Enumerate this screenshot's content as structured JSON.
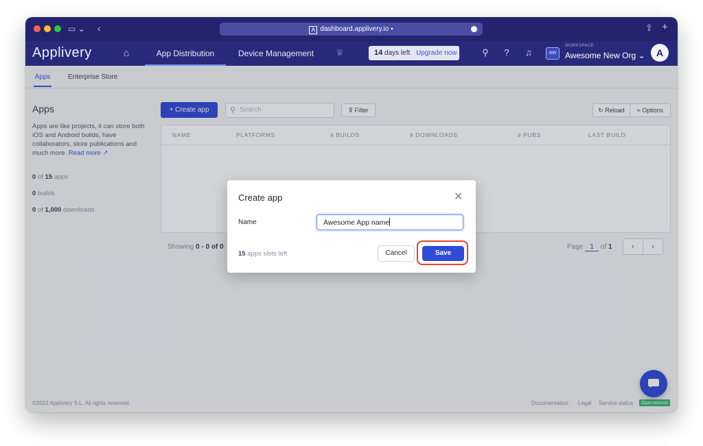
{
  "browser": {
    "url": "dashboard.applivery.io",
    "colors": {
      "close": "#ff5f57",
      "minimize": "#febc2e",
      "maximize": "#28c840"
    }
  },
  "header": {
    "logo": "Applivery",
    "nav": [
      "App Distribution",
      "Device Management"
    ],
    "trial": {
      "days": "14",
      "days_suffix": "days left",
      "upgrade": "Upgrade now"
    },
    "workspace": {
      "initials": "AW",
      "label": "WORKSPACE",
      "name": "Awesome New Org"
    }
  },
  "subnav": {
    "tabs": [
      "Apps",
      "Enterprise Store"
    ]
  },
  "sidebar": {
    "title": "Apps",
    "description": "Apps are like projects, it can store both iOS and Android builds, have collaborators, store publications and much more.",
    "read_more": "Read more",
    "stats": {
      "apps_used": "0",
      "apps_of": "of",
      "apps_total": "15",
      "apps_unit": "apps",
      "builds": "0",
      "builds_unit": "builds",
      "downloads_used": "0",
      "downloads_of": "of",
      "downloads_total": "1,000",
      "downloads_unit": "downloads"
    }
  },
  "toolbar": {
    "create": "+ Create app",
    "search_placeholder": "Search",
    "filter": "Filter",
    "reload": "Reload",
    "options": "Options"
  },
  "table": {
    "columns": [
      "NAME",
      "PLATFORMS",
      "# BUILDS",
      "# DOWNLOADS",
      "# PUBS",
      "LAST BUILD"
    ]
  },
  "pagination": {
    "showing_prefix": "Showing",
    "range": "0 - 0 of 0",
    "page_label": "Page",
    "page": "1",
    "of": "of",
    "total": "1",
    "prev": "‹",
    "next": "›"
  },
  "footer": {
    "copyright": "©2022 Applivery S.L. All rights reserved.",
    "links": [
      "Documentation",
      "Legal",
      "Service status"
    ],
    "status": "Operational"
  },
  "modal": {
    "title": "Create app",
    "name_label": "Name",
    "name_value": "Awesome App name",
    "slots_count": "15",
    "slots_text": "apps slots left",
    "cancel": "Cancel",
    "save": "Save"
  }
}
